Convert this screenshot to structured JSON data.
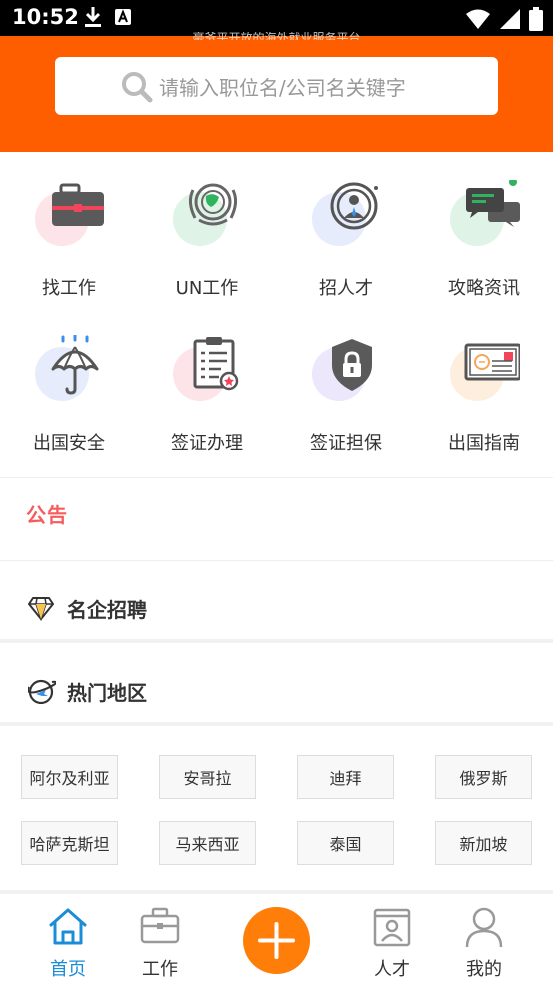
{
  "status_bar": {
    "time": "10:52",
    "left_icons": [
      "download-icon",
      "font-a-icon"
    ],
    "right_icons": [
      "wifi-icon",
      "signal-icon",
      "battery-icon"
    ]
  },
  "header": {
    "slogan": "豪爷平开放的海外就业服务平台",
    "search_placeholder": "请输入职位名/公司名关键字",
    "background_color": "#ff5e00"
  },
  "grid": {
    "items": [
      {
        "label": "找工作",
        "icon": "briefcase-icon"
      },
      {
        "label": "UN工作",
        "icon": "un-emblem-icon"
      },
      {
        "label": "招人才",
        "icon": "recruit-person-icon"
      },
      {
        "label": "攻略资讯",
        "icon": "chat-bubbles-icon"
      },
      {
        "label": "出国安全",
        "icon": "umbrella-icon"
      },
      {
        "label": "签证办理",
        "icon": "clipboard-icon"
      },
      {
        "label": "签证担保",
        "icon": "shield-lock-icon"
      },
      {
        "label": "出国指南",
        "icon": "postcard-icon"
      }
    ]
  },
  "notice": {
    "label": "公告"
  },
  "sections": {
    "famous_companies": "名企招聘",
    "hot_regions": "热门地区"
  },
  "regions": [
    "阿尔及利亚",
    "安哥拉",
    "迪拜",
    "俄罗斯",
    "哈萨克斯坦",
    "马来西亚",
    "泰国",
    "新加坡"
  ],
  "tab_bar": {
    "tabs": [
      {
        "label": "首页",
        "icon": "home-icon",
        "active": true
      },
      {
        "label": "工作",
        "icon": "briefcase-icon",
        "active": false
      },
      {
        "label": "人才",
        "icon": "id-card-icon",
        "active": false
      },
      {
        "label": "我的",
        "icon": "user-icon",
        "active": false
      }
    ],
    "fab_icon": "plus-icon",
    "active_color": "#1a8cd8",
    "fab_color": "#ff7e0a"
  }
}
